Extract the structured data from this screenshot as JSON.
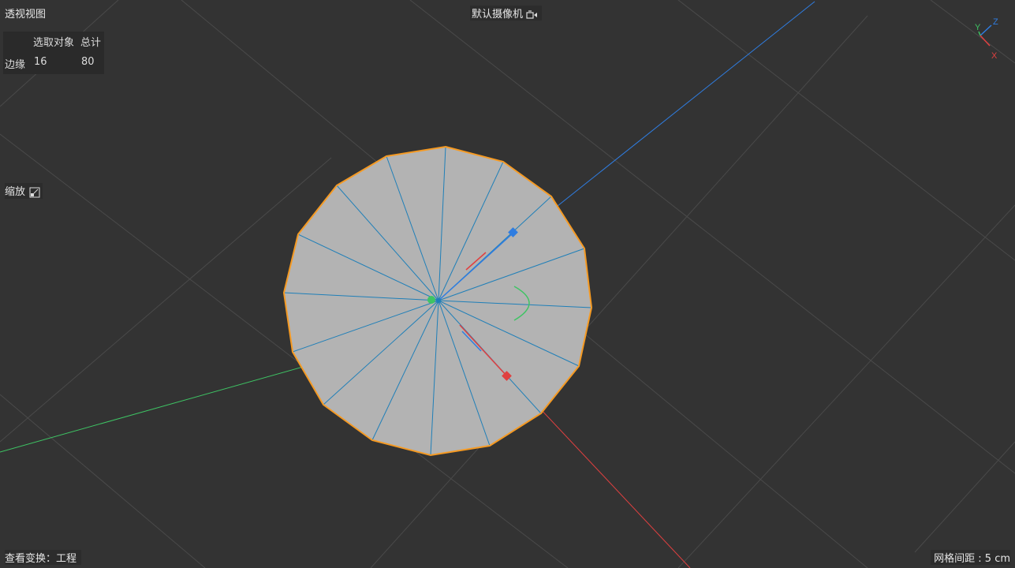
{
  "viewport": {
    "title": "透视视图",
    "camera": "默认摄像机",
    "zoom_label": "缩放",
    "view_transform": "查看变换：工程",
    "grid_spacing": "网格间距 : 5 cm"
  },
  "stats": {
    "col_selected": "选取对象",
    "col_total": "总计",
    "row_label": "边缘",
    "selected": "16",
    "total": "80"
  },
  "gizmo": {
    "axis_y": "Y",
    "axis_z": "Z",
    "axis_x": "X"
  },
  "icons": {
    "camera": "camera-icon",
    "zoom": "zoom-icon"
  },
  "colors": {
    "background": "#333333",
    "grid": "#4a4a4a",
    "mesh_fill": "#b3b3b3",
    "edge": "#1f7fb8",
    "outline": "#f59a23",
    "axis_x": "#e04040",
    "axis_y": "#3ec464",
    "axis_z": "#2f7de1"
  }
}
